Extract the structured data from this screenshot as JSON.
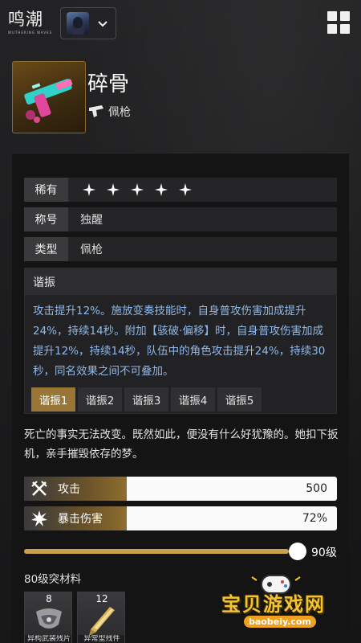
{
  "header": {
    "logo_text": "鸣潮",
    "logo_sub": "WUTHERING WAVES"
  },
  "weapon": {
    "name": "碎骨",
    "type": "佩枪"
  },
  "info_rows": {
    "rarity_label": "稀有",
    "rarity_stars": 5,
    "title_label": "称号",
    "title_value": "独醒",
    "type_label": "类型",
    "type_value": "佩枪"
  },
  "resonance": {
    "title": "谐振",
    "text": "攻击提升12%。施放变奏技能时，自身普攻伤害加成提升24%，持续14秒。附加【骇破·偏移】时，自身普攻伤害加成提升12%，持续14秒，队伍中的角色攻击提升24%，持续30秒，同名效果之间不可叠加。",
    "tabs": [
      "谐振1",
      "谐振2",
      "谐振3",
      "谐振4",
      "谐振5"
    ],
    "active_tab": 0
  },
  "description": "死亡的事实无法改变。既然如此，便没有什么好犹豫的。她扣下扳机，亲手摧毁依存的梦。",
  "stats": [
    {
      "icon": "crossed-swords-icon",
      "label": "攻击",
      "value": "500"
    },
    {
      "icon": "burst-icon",
      "label": "暴击伤害",
      "value": "72%"
    }
  ],
  "level_slider": {
    "value_fraction": 1.0,
    "level_text": "90级"
  },
  "materials": {
    "title": "80级突材料",
    "items": [
      {
        "count": "8",
        "name": "异构武装残片"
      },
      {
        "count": "12",
        "name": "异常型残件"
      }
    ]
  },
  "watermark": {
    "text": "宝贝游戏网",
    "url": "baobeiy.com"
  },
  "colors": {
    "accent_gold": "#9a7636",
    "resonance_text": "#8fb8ea",
    "watermark_yellow": "#f4c430"
  }
}
